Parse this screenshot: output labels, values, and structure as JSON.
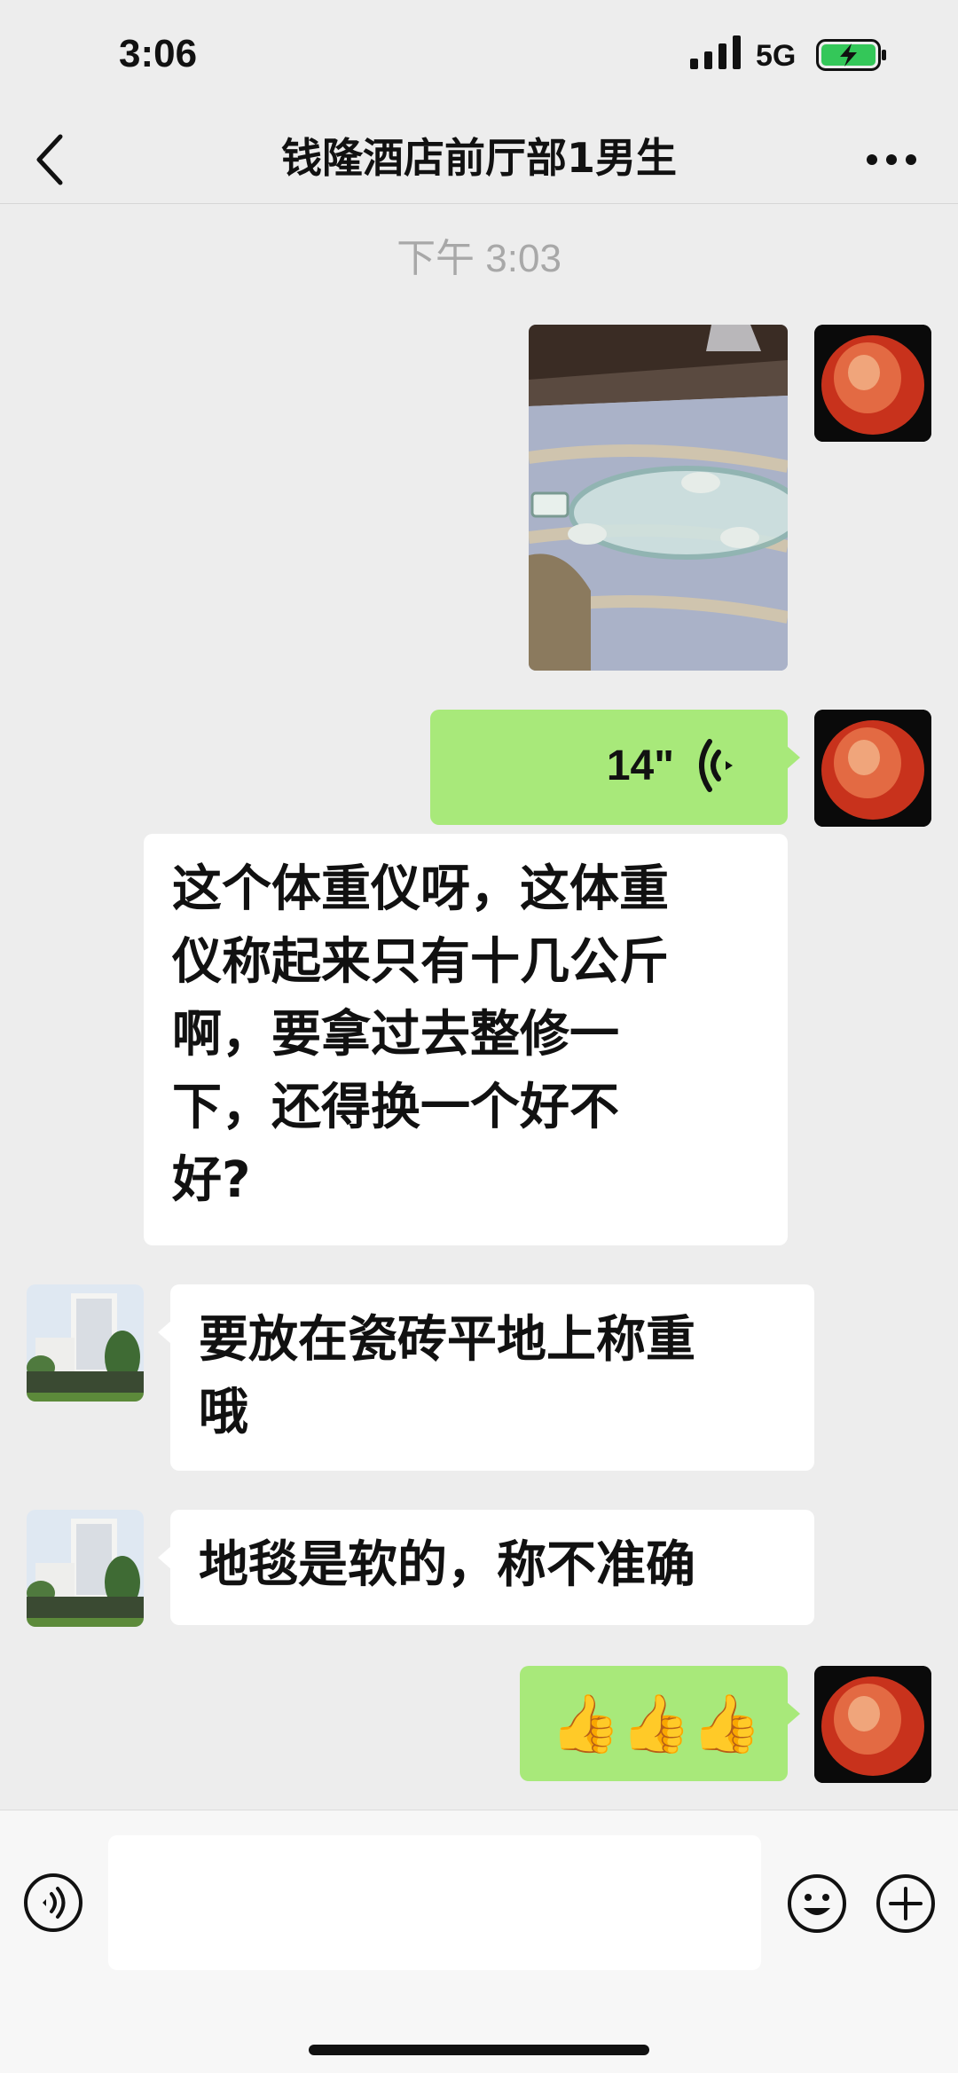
{
  "status_bar": {
    "time": "3:06",
    "network": "5G"
  },
  "header": {
    "title": "钱隆酒店前厅部1男生"
  },
  "timestamp": "下午 3:03",
  "messages": [
    {
      "sender": "self",
      "type": "image",
      "description": "scale-on-carpet-photo"
    },
    {
      "sender": "self",
      "type": "voice",
      "duration": "14\""
    },
    {
      "sender": "self",
      "type": "text",
      "lines": [
        "这个体重仪呀，这体重",
        "仪称起来只有十几公斤",
        "啊，要拿过去整修一",
        "下，还得换一个好不",
        "好?"
      ]
    },
    {
      "sender": "other",
      "type": "text",
      "lines": [
        "要放在瓷砖平地上称重",
        "哦"
      ]
    },
    {
      "sender": "other",
      "type": "text",
      "lines": [
        "地毯是软的，称不准确"
      ]
    },
    {
      "sender": "self",
      "type": "emoji",
      "text": "👍👍👍"
    }
  ],
  "colors": {
    "background": "#ededed",
    "self_bubble": "#a8e97a",
    "other_bubble": "#ffffff",
    "battery_fill": "#34c759"
  },
  "icons": {
    "back": "chevron-left-icon",
    "more": "more-dots-icon",
    "voice": "voice-waves-icon",
    "emoji": "smiley-icon",
    "plus": "plus-circle-icon"
  }
}
